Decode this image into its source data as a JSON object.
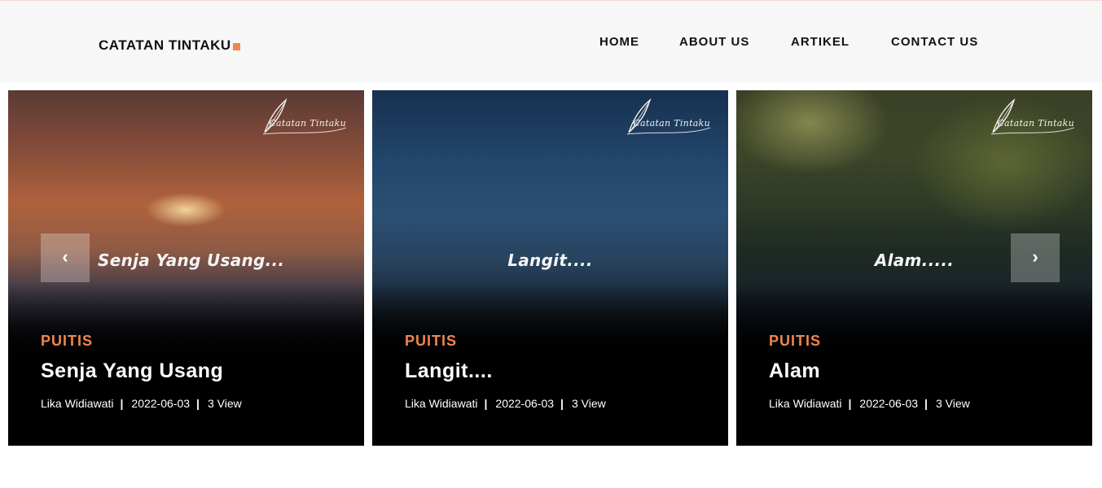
{
  "brand": {
    "name": "CATATAN TINTAKU",
    "accent": "#f0864f"
  },
  "nav": [
    {
      "label": "HOME"
    },
    {
      "label": "ABOUT US"
    },
    {
      "label": "ARTIKEL"
    },
    {
      "label": "CONTACT US"
    }
  ],
  "cards": [
    {
      "logo_text": "Catatan Tintaku",
      "overlay_text": "Senja Yang Usang...",
      "category": "PUITIS",
      "title": "Senja Yang Usang",
      "author": "Lika Widiawati",
      "date": "2022-06-03",
      "views": "3 View"
    },
    {
      "logo_text": "Catatan Tintaku",
      "overlay_text": "Langit....",
      "category": "PUITIS",
      "title": "Langit....",
      "author": "Lika Widiawati",
      "date": "2022-06-03",
      "views": "3 View"
    },
    {
      "logo_text": "Catatan Tintaku",
      "overlay_text": "Alam.....",
      "category": "PUITIS",
      "title": "Alam",
      "author": "Lika Widiawati",
      "date": "2022-06-03",
      "views": "3 View"
    }
  ],
  "carousel": {
    "prev_icon": "‹",
    "next_icon": "›"
  },
  "separator": "|"
}
